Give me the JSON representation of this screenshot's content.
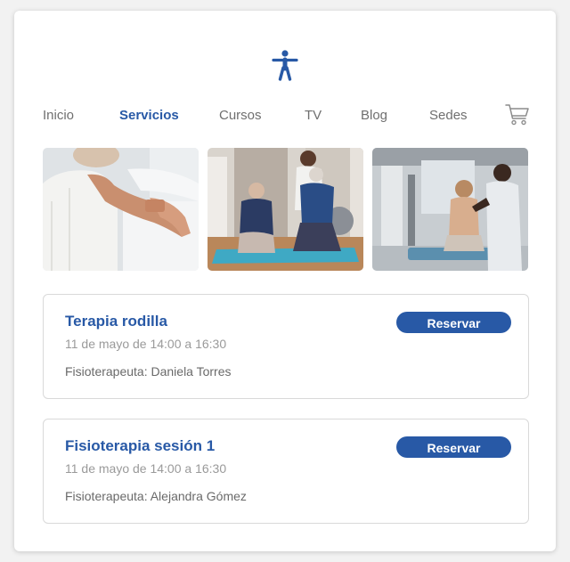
{
  "nav": {
    "items": [
      {
        "label": "Inicio",
        "active": false
      },
      {
        "label": "Servicios",
        "active": true
      },
      {
        "label": "Cursos",
        "active": false
      },
      {
        "label": "TV",
        "active": false
      },
      {
        "label": "Blog",
        "active": false
      },
      {
        "label": "Sedes",
        "active": false
      }
    ]
  },
  "icons": {
    "logo": "person-icon",
    "cart": "shopping-cart-icon"
  },
  "colors": {
    "accent": "#2859a6",
    "muted_text": "#9a9a9a",
    "body_text": "#6a6a6a",
    "card_border": "#d9d9d9"
  },
  "appointments": [
    {
      "title": "Terapia rodilla",
      "date": "11 de mayo de 14:00 a 16:30",
      "therapist": "Fisioterapeuta: Daniela Torres",
      "button": "Reservar"
    },
    {
      "title": "Fisioterapia sesión 1",
      "date": "11 de mayo de 14:00 a 16:30",
      "therapist": "Fisioterapeuta: Alejandra Gómez",
      "button": "Reservar"
    }
  ]
}
